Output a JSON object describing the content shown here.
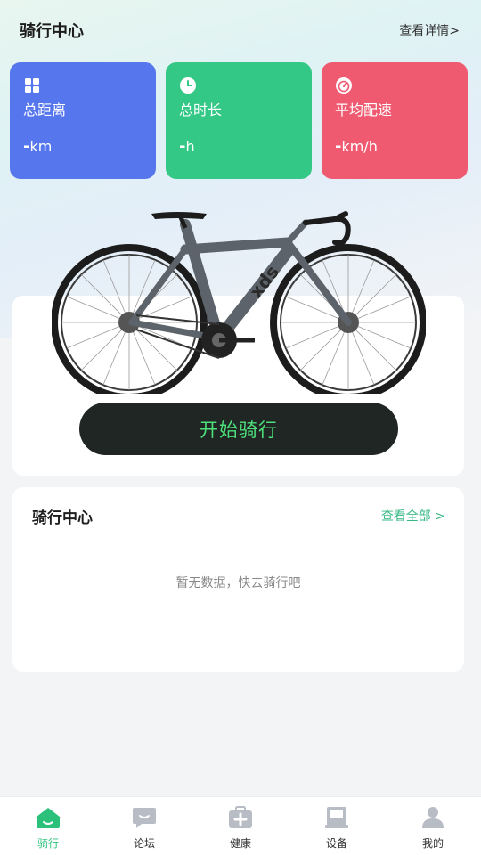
{
  "header": {
    "title": "骑行中心",
    "details_link": "查看详情>"
  },
  "stats": [
    {
      "label": "总距离",
      "value": "-",
      "unit": "km",
      "icon": "grid-icon",
      "color": "#5676ee"
    },
    {
      "label": "总时长",
      "value": "-",
      "unit": "h",
      "icon": "clock-icon",
      "color": "#33c886"
    },
    {
      "label": "平均配速",
      "value": "-",
      "unit": "km/h",
      "icon": "speedometer-icon",
      "color": "#ef5a70"
    }
  ],
  "ride": {
    "start_button": "开始骑行",
    "bike_image": "road-bike-image"
  },
  "records": {
    "title": "骑行中心",
    "view_all": "查看全部 >",
    "empty_text": "暂无数据，快去骑行吧"
  },
  "tabbar": {
    "active_color": "#2cc17b",
    "items": [
      {
        "label": "骑行",
        "icon": "home-icon",
        "active": true
      },
      {
        "label": "论坛",
        "icon": "chat-icon",
        "active": false
      },
      {
        "label": "健康",
        "icon": "medical-kit-icon",
        "active": false
      },
      {
        "label": "设备",
        "icon": "device-icon",
        "active": false
      },
      {
        "label": "我的",
        "icon": "user-icon",
        "active": false
      }
    ]
  }
}
